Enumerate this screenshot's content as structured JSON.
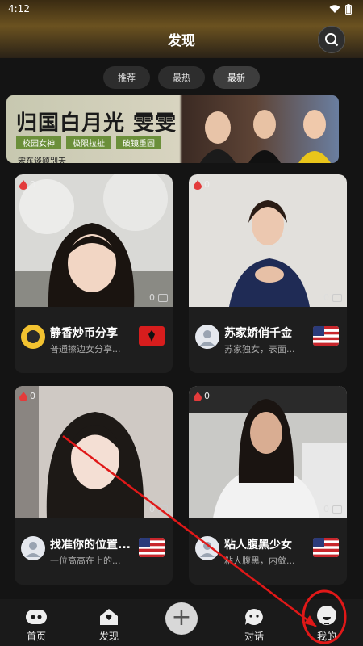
{
  "status": {
    "time": "4:12"
  },
  "header": {
    "title": "发现"
  },
  "tabs": [
    {
      "label": "推荐"
    },
    {
      "label": "最热"
    },
    {
      "label": "最新"
    }
  ],
  "banner": {
    "title": "归国白月光 雯雯",
    "tags": [
      "校园女神",
      "极限拉扯",
      "破镜重圆"
    ],
    "subtitle": "宋东谈颖别天"
  },
  "cards": [
    {
      "likes": "0",
      "count": "0",
      "name": "静香炒币分享",
      "desc": "普通擦边女分享...",
      "flag": "albania"
    },
    {
      "likes": "0",
      "count": "0",
      "name": "苏家娇俏千金",
      "desc": "苏家独女，表面...",
      "flag": "usa"
    },
    {
      "likes": "0",
      "count": "0",
      "name": "找准你的位置...",
      "desc": "一位高高在上的...",
      "flag": "usa"
    },
    {
      "likes": "0",
      "count": "0",
      "name": "粘人腹黑少女",
      "desc": "粘人腹黑，内敛...",
      "flag": "usa"
    }
  ],
  "nav": {
    "home": "首页",
    "discover": "发现",
    "chat": "对话",
    "mine": "我的"
  },
  "colors": {
    "accent": "#e33b3b",
    "annotation": "#e01818"
  }
}
